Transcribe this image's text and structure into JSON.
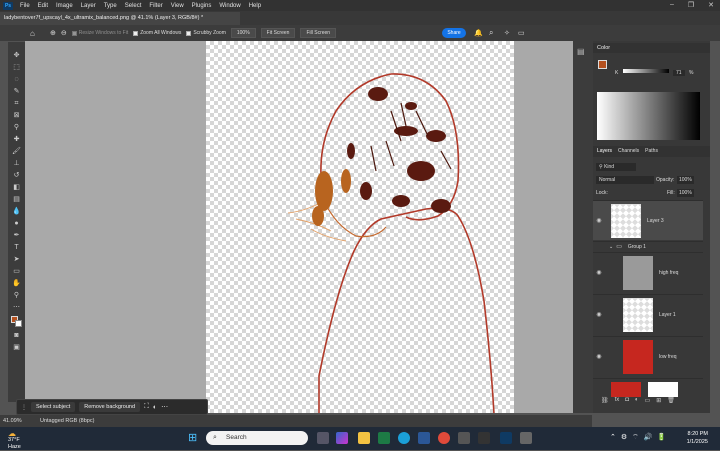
{
  "menubar": {
    "items": [
      "File",
      "Edit",
      "Image",
      "Layer",
      "Type",
      "Select",
      "Filter",
      "View",
      "Plugins",
      "Window",
      "Help"
    ]
  },
  "document": {
    "tab_title": "ladybentover7f_upscayl_4x_ultramix_balanced.png @ 41.1% (Layer 3, RGB/8#) *"
  },
  "options": {
    "resize_windows": "Resize Windows to Fit",
    "zoom_all": "Zoom All Windows",
    "scrubby_zoom": "Scrubby Zoom",
    "zoom_pct": "100%",
    "fit_screen": "Fit Screen",
    "fill_screen": "Fill Screen",
    "share": "Share"
  },
  "context": {
    "select_subject": "Select subject",
    "remove_background": "Remove background"
  },
  "status": {
    "zoom": "41.09%",
    "profile": "Untagged RGB (8bpc)"
  },
  "color_panel": {
    "title": "Color",
    "k_label": "K",
    "k_value": "71",
    "k_unit": "%"
  },
  "layers_panel": {
    "tabs": [
      "Layers",
      "Channels",
      "Paths"
    ],
    "kind": "Kind",
    "blend": "Normal",
    "opacity_label": "Opacity:",
    "opacity": "100%",
    "lock_label": "Lock:",
    "fill_label": "Fill:",
    "fill": "100%",
    "layers": [
      {
        "name": "Layer 3"
      },
      {
        "name": "Group 1"
      },
      {
        "name": "high freq"
      },
      {
        "name": "Layer 1"
      },
      {
        "name": "low freq"
      }
    ]
  },
  "taskbar": {
    "temp": "37°F",
    "weather": "Haze",
    "search": "Search",
    "time": "8:20 PM",
    "date": "1/1/2025"
  },
  "colors": {
    "accent": "#1473e6",
    "foreground": "#b5511f",
    "outline": "#b23a2a"
  }
}
